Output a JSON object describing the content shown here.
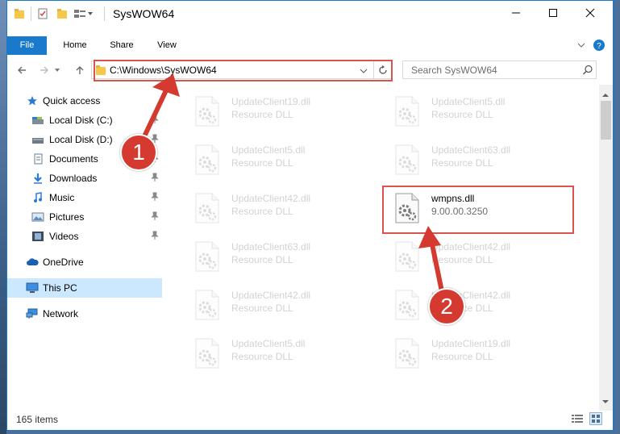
{
  "window": {
    "title": "SysWOW64"
  },
  "ribbon": {
    "tabs": [
      "File",
      "Home",
      "Share",
      "View"
    ]
  },
  "address": {
    "path": "C:\\Windows\\SysWOW64"
  },
  "search": {
    "placeholder": "Search SysWOW64"
  },
  "sidebar": {
    "items": [
      {
        "label": "Quick access",
        "icon": "star-icon"
      },
      {
        "label": "Local Disk (C:)",
        "icon": "drive-icon",
        "pinned": true
      },
      {
        "label": "Local Disk (D:)",
        "icon": "drive-icon",
        "pinned": true
      },
      {
        "label": "Documents",
        "icon": "documents-icon",
        "pinned": true
      },
      {
        "label": "Downloads",
        "icon": "download-icon",
        "pinned": true
      },
      {
        "label": "Music",
        "icon": "music-icon",
        "pinned": true
      },
      {
        "label": "Pictures",
        "icon": "pictures-icon",
        "pinned": true
      },
      {
        "label": "Videos",
        "icon": "videos-icon",
        "pinned": true
      },
      {
        "label": "OneDrive",
        "icon": "cloud-icon"
      },
      {
        "label": "This PC",
        "icon": "computer-icon",
        "selected": true
      },
      {
        "label": "Network",
        "icon": "network-icon"
      }
    ]
  },
  "files": [
    {
      "name": "UpdateClient19.dll",
      "desc": "Resource DLL"
    },
    {
      "name": "UpdateClient5.dll",
      "desc": "Resource DLL"
    },
    {
      "name": "UpdateClient5.dll",
      "desc": "Resource DLL"
    },
    {
      "name": "UpdateClient63.dll",
      "desc": "Resource DLL"
    },
    {
      "name": "UpdateClient42.dll",
      "desc": "Resource DLL"
    },
    {
      "name": "wmpns.dll",
      "desc": "9.00.00.3250",
      "highlight": true
    },
    {
      "name": "UpdateClient63.dll",
      "desc": "Resource DLL"
    },
    {
      "name": "UpdateClient42.dll",
      "desc": "Resource DLL"
    },
    {
      "name": "UpdateClient42.dll",
      "desc": "Resource DLL"
    },
    {
      "name": "UpdateClient42.dll",
      "desc": "Resource DLL"
    },
    {
      "name": "UpdateClient5.dll",
      "desc": "Resource DLL"
    },
    {
      "name": "UpdateClient19.dll",
      "desc": "Resource DLL"
    }
  ],
  "status": {
    "items_count": "165 items"
  },
  "annotations": {
    "step1": "1",
    "step2": "2",
    "color": "#d43a30"
  }
}
